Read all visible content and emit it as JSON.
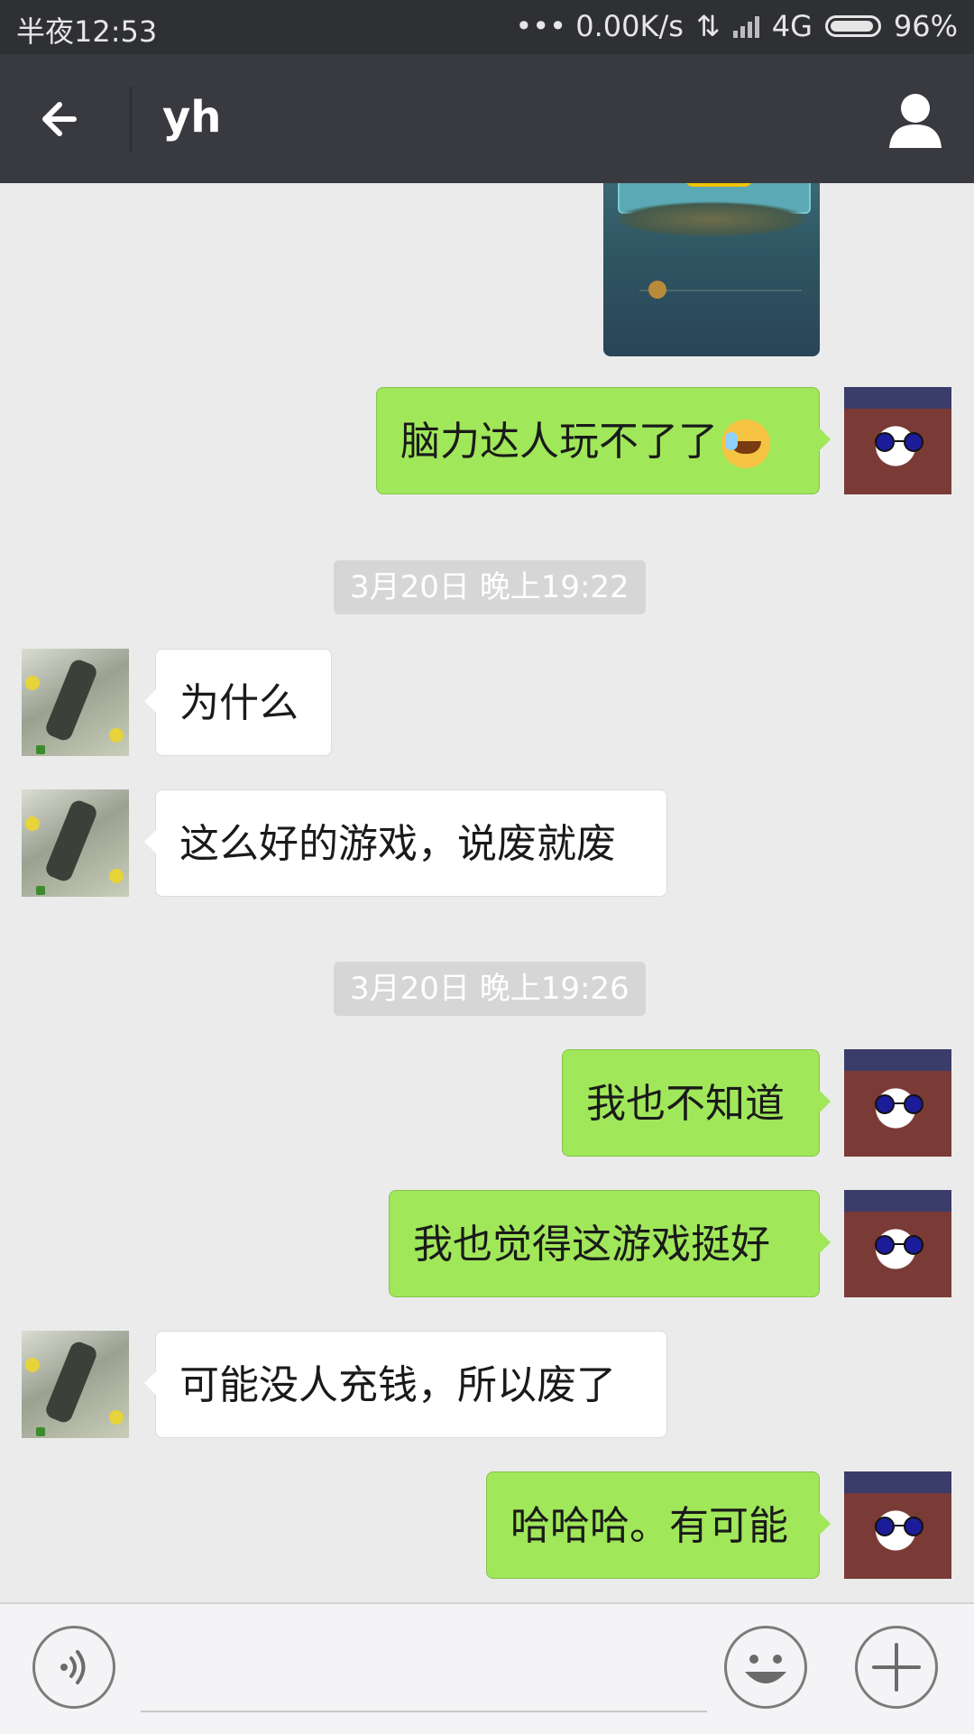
{
  "status_bar": {
    "time": "半夜12:53",
    "network_speed": "••• 0.00K/s",
    "network_type": "4G",
    "battery": "96%"
  },
  "header": {
    "title": "yh"
  },
  "messages": [
    {
      "type": "image",
      "from": "me"
    },
    {
      "type": "text",
      "from": "me",
      "text": "脑力达人玩不了了",
      "emoji": "crying-laughing-emoji"
    },
    {
      "type": "timestamp",
      "text": "3月20日 晚上19:22"
    },
    {
      "type": "text",
      "from": "friend",
      "text": "为什么"
    },
    {
      "type": "text",
      "from": "friend",
      "text": "这么好的游戏，说废就废"
    },
    {
      "type": "timestamp",
      "text": "3月20日 晚上19:26"
    },
    {
      "type": "text",
      "from": "me",
      "text": "我也不知道"
    },
    {
      "type": "text",
      "from": "me",
      "text": "我也觉得这游戏挺好"
    },
    {
      "type": "text",
      "from": "friend",
      "text": "可能没人充钱，所以废了"
    },
    {
      "type": "text",
      "from": "me",
      "text": "哈哈哈。有可能"
    }
  ],
  "input": {
    "value": "",
    "placeholder": ""
  },
  "colors": {
    "sent_bubble": "#a0e75a",
    "received_bubble": "#ffffff",
    "header_bg": "#393a3f",
    "status_bg": "#2f3034"
  }
}
